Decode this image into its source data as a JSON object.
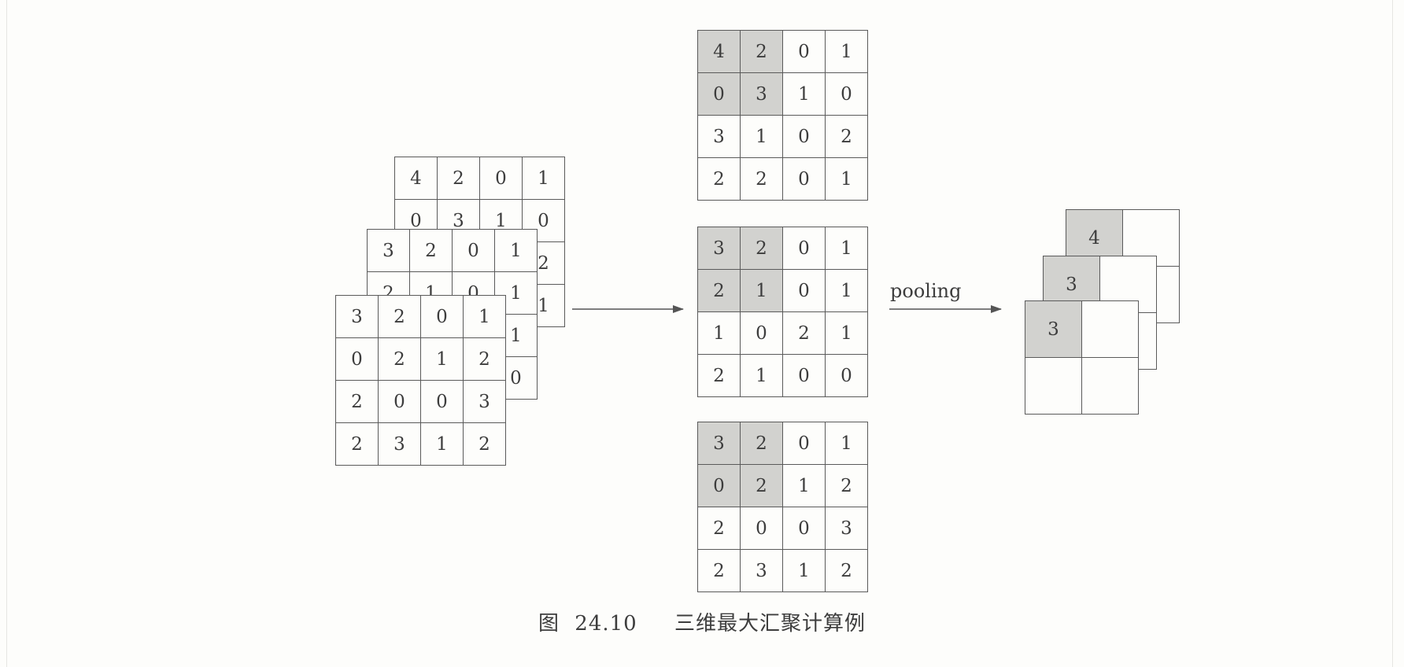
{
  "caption": {
    "figure": "图",
    "number": "24.10",
    "title": "三维最大汇聚计算例"
  },
  "input_stack": [
    [
      [
        "4",
        "2",
        "0",
        "1"
      ],
      [
        "0",
        "3",
        "1",
        "0"
      ],
      [
        "3",
        "1",
        "0",
        "2"
      ],
      [
        "2",
        "2",
        "0",
        "1"
      ]
    ],
    [
      [
        "3",
        "2",
        "0",
        "1"
      ],
      [
        "2",
        "1",
        "0",
        "1"
      ],
      [
        "1",
        "0",
        "2",
        "1"
      ],
      [
        "2",
        "1",
        "0",
        "0"
      ]
    ],
    [
      [
        "3",
        "2",
        "0",
        "1"
      ],
      [
        "0",
        "2",
        "1",
        "2"
      ],
      [
        "2",
        "0",
        "0",
        "3"
      ],
      [
        "2",
        "3",
        "1",
        "2"
      ]
    ]
  ],
  "separated_slices": [
    [
      [
        "4",
        "2",
        "0",
        "1"
      ],
      [
        "0",
        "3",
        "1",
        "0"
      ],
      [
        "3",
        "1",
        "0",
        "2"
      ],
      [
        "2",
        "2",
        "0",
        "1"
      ]
    ],
    [
      [
        "3",
        "2",
        "0",
        "1"
      ],
      [
        "2",
        "1",
        "0",
        "1"
      ],
      [
        "1",
        "0",
        "2",
        "1"
      ],
      [
        "2",
        "1",
        "0",
        "0"
      ]
    ],
    [
      [
        "3",
        "2",
        "0",
        "1"
      ],
      [
        "0",
        "2",
        "1",
        "2"
      ],
      [
        "2",
        "0",
        "0",
        "3"
      ],
      [
        "2",
        "3",
        "1",
        "2"
      ]
    ]
  ],
  "output_stack": [
    [
      [
        "4",
        ""
      ],
      [
        "",
        ""
      ]
    ],
    [
      [
        "3",
        ""
      ],
      [
        "",
        ""
      ]
    ],
    [
      [
        "3",
        ""
      ],
      [
        "",
        ""
      ]
    ]
  ],
  "arrow_label": "pooling",
  "colors": {
    "highlight": "#d2d2cf",
    "line": "#5a5a5a",
    "background": "#fdfdfb"
  }
}
